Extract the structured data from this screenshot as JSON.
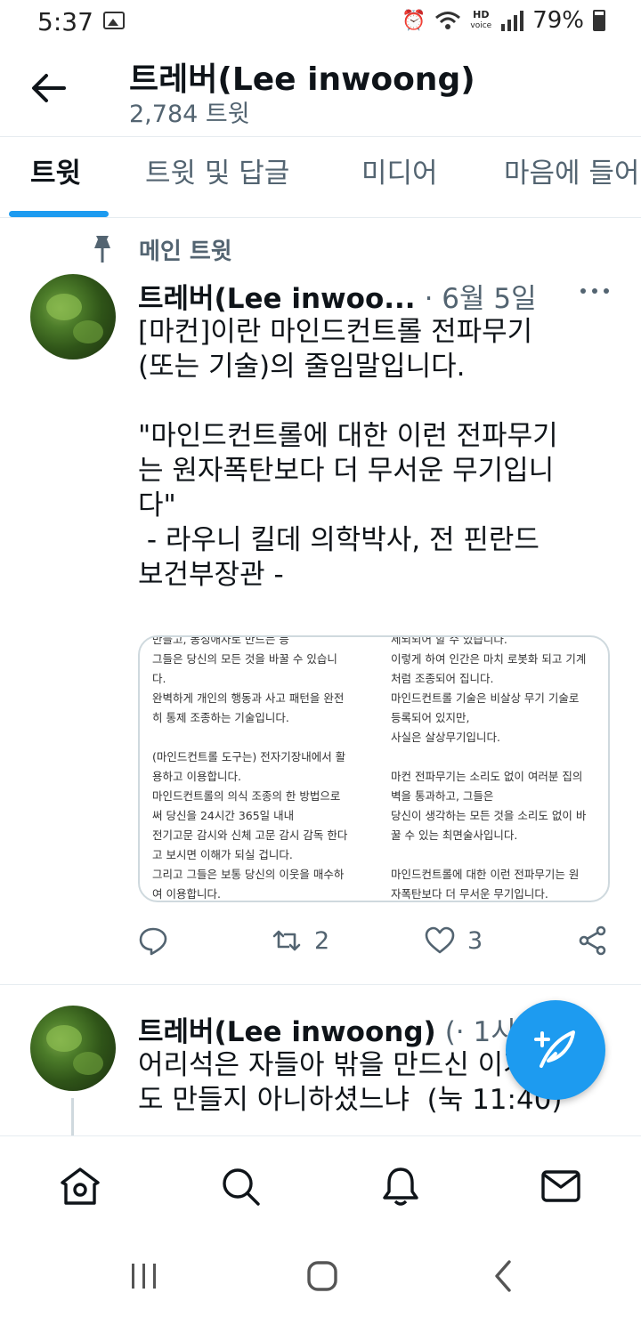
{
  "status_bar": {
    "time": "5:37",
    "hd_top": "HD",
    "hd_bottom": "voice",
    "battery": "79%"
  },
  "header": {
    "profile_name": "트레버(Lee inwoong)",
    "tweet_count": "2,784 트윗"
  },
  "tabs": [
    {
      "label": "트윗"
    },
    {
      "label": "트윗 및 답글"
    },
    {
      "label": "미디어"
    },
    {
      "label": "마음에 들어"
    }
  ],
  "pinned": {
    "label": "메인 트윗"
  },
  "tweet1": {
    "name": "트레버(Lee inwoo...",
    "date": "· 6월 5일",
    "text": "[마컨]이란 마인드컨트롤 전파무기\n(또는 기술)의 줄임말입니다.\n\n\"마인드컨트롤에 대한 이런 전파무기\n는 원자폭탄보다 더 무서운 무기입니\n다\"\n - 라우니 킬데 의학박사, 전 핀란드\n보건부장관 -",
    "media_left": "만들고, 동성애자로 만드는 등\n그들은 당신의 모든 것을 바꿀 수 있습니\n다.\n완벽하게 개인의 행동과 사고 패턴을 완전\n히 통제 조종하는 기술입니다.\n\n(마인드컨트롤 도구는) 전자기장내에서 활\n용하고 이용합니다.\n마인드컨트롤의 의식 조종의 한 방법으로\n써 당신을 24시간 365일 내내\n전기고문 감시와 신체 고문 감시 감독 한다\n고 보시면 이해가 되실 겁니다.\n그리고 그들은 보통 당신의 이웃을 매수하\n여 이용합니다.",
    "media_right": "세뇌되어 할 수 있습니다.\n이렇게 하여 인간은 마치 로봇화 되고 기계\n처럼 조종되어 집니다.\n마인드컨트롤 기술은 비살상 무기 기술로\n등록되어 있지만,\n사실은 살상무기입니다.\n\n마컨 전파무기는 소리도 없이 여러분 집의\n벽을 통과하고, 그들은\n당신이 생각하는 모든 것을 소리도 없이 바\n꿀 수 있는 최면술사입니다.\n\n마인드컨트롤에 대한 이런 전파무기는 원\n자폭탄보다 더 무서운 무기입니다.",
    "retweets": "2",
    "likes": "3"
  },
  "tweet2": {
    "name": "트레버(Lee inwoong)",
    "date": "(· 1시간",
    "text": "어리석은 자들아 밖을 만드신 이가 안\n도 만들지 아니하셨느냐  (눅 11:40)"
  },
  "colors": {
    "accent": "#1d9bf0",
    "text": "#0f1419",
    "secondary": "#536471",
    "border": "#e6ecf0"
  },
  "icons": {
    "back": "arrow-left-icon",
    "pin": "pin-icon",
    "reply": "reply-icon",
    "retweet": "retweet-icon",
    "like": "heart-icon",
    "share": "share-icon",
    "compose": "compose-feather-icon",
    "home": "home-icon",
    "search": "search-icon",
    "notifications": "bell-icon",
    "messages": "mail-icon"
  }
}
